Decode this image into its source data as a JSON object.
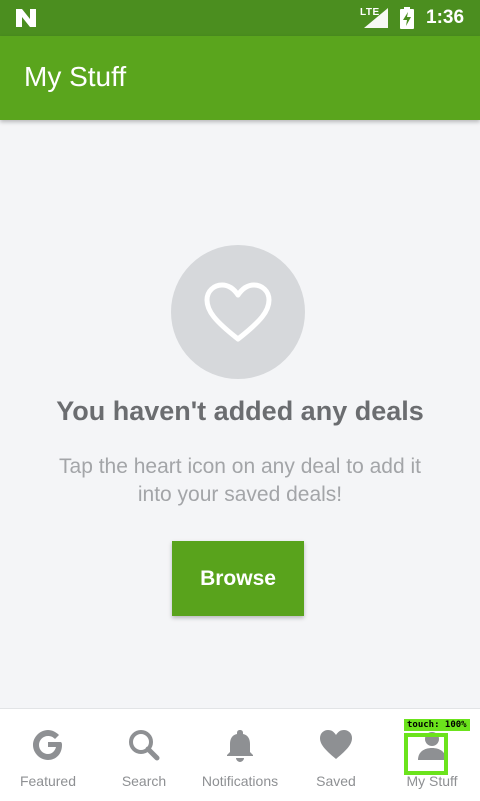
{
  "status_bar": {
    "network": "LTE",
    "time": "1:36",
    "icons": [
      "android-n-icon",
      "signal-icon",
      "battery-charging-icon"
    ]
  },
  "app_bar": {
    "title": "My Stuff",
    "color": "#5aa51d"
  },
  "empty_state": {
    "icon": "heart-outline-icon",
    "heading": "You haven't added any deals",
    "message": "Tap the heart icon on any deal to add it into your saved deals!",
    "button_label": "Browse"
  },
  "bottom_nav": {
    "items": [
      {
        "label": "Featured",
        "icon": "g-logo-icon"
      },
      {
        "label": "Search",
        "icon": "search-icon"
      },
      {
        "label": "Notifications",
        "icon": "bell-icon"
      },
      {
        "label": "Saved",
        "icon": "heart-icon"
      },
      {
        "label": "My Stuff",
        "icon": "person-icon"
      }
    ]
  },
  "touch_overlay": {
    "label": "touch: 100%",
    "color": "#6be31c"
  },
  "colors": {
    "primary": "#5aa51d",
    "status_bar": "#4b8e1f",
    "background": "#f4f5f7"
  }
}
